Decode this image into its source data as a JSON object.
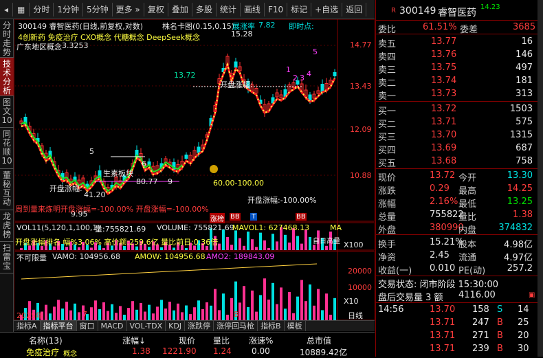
{
  "toolbar": {
    "items": [
      "分时",
      "1分钟",
      "5分钟",
      "更多",
      "复权",
      "叠加",
      "多股",
      "统计",
      "画线",
      "F10",
      "标记",
      "+自选",
      "返回"
    ]
  },
  "left_tabs": [
    "分时走势",
    "技术分析",
    "图文10",
    "同花顺10",
    "董秘互动",
    "龙虎榜",
    "扫雷宝"
  ],
  "chart": {
    "title": "300149 睿智医药(日线,前复权,对数)",
    "stock_window_label": "株名卡图(0.15,0.15)",
    "tab_zhang": "展涨率",
    "zhang_value": "7.82",
    "ji_shi": "即时点:",
    "concepts": "4创新药 免疫治疗 CXO概念 代糖概念 DeepSeek概念",
    "note_line": "广东地区概念",
    "dash_value": "3.3253",
    "price_labels": [
      "14.77",
      "13.43",
      "12.09",
      "10.88",
      "9.95"
    ],
    "price_axis_labels": [
      "14.77",
      "13.43",
      "12.09",
      "10.88"
    ],
    "high_label": "15.28",
    "low_label": "9.95",
    "level_label": "13.72",
    "open_zf_label": "开盘涨幅:",
    "open_zf_label2": "开盘涨幅:",
    "open_zf_label3": "开盘涨幅:-100.00%",
    "zhengti": "生素板块",
    "lbl_4120": "41.20",
    "lbl_8077": "80.77",
    "range_label": "60.00-100.00",
    "marks": [
      "5",
      "6",
      "9",
      "1",
      "2",
      "3",
      "4",
      "5"
    ],
    "bb_labels": [
      "BB",
      "T",
      "BB"
    ],
    "zhang_badge": "涨榜",
    "red_text": "周到量来炼明开盘涨幅=-100.00% 开盘涨幅=-100.00%",
    "xaxis": [
      "2025年",
      "7",
      "8"
    ],
    "day_label": "日线"
  },
  "vol_panel": {
    "title": "VOL11(5,120,1,100,1)",
    "vol": "量:755821.69",
    "volume": "VOLUME: 755821.69",
    "mavol": "MAVOL1: 627468.13",
    "ma_extra": "MA",
    "yellow_line": "开盘涨幅排名 幅%3.06% 高价额:259.6亿 量比前日:0.36倍",
    "scale": "X100",
    "right_label": "自日高量"
  },
  "amo_panel": {
    "title": "不可限量",
    "vamo": "VAMO: 104956.68",
    "amow": "AMOW: 104956.68",
    "amo2": "AMO2: 189843.09",
    "y_labels": [
      "20000",
      "10000"
    ],
    "scale": "X10"
  },
  "bottom_tabs": [
    "指标A",
    "指标平台",
    "窗口",
    "MACD",
    "VOL-TDX",
    "KDJ",
    "涨跌停",
    "涨停回马枪",
    "指标B",
    "模板"
  ],
  "table": {
    "headers": [
      "名称(13)",
      "涨幅↓",
      "现价",
      "量比",
      "涨速%",
      "总市值"
    ],
    "row": [
      "免疫治疗",
      "1.38",
      "1221.90",
      "1.24",
      "0.00",
      "10889.42亿"
    ],
    "row_tag": "概念"
  },
  "quote": {
    "code": "300149",
    "name": "睿智医药",
    "price": "14.23",
    "weibi_label": "委比",
    "weibi": "61.51%",
    "weicha_label": "委差",
    "weicha": "3685",
    "asks": [
      {
        "label": "卖五",
        "price": "13.77",
        "vol": "16"
      },
      {
        "label": "卖四",
        "price": "13.76",
        "vol": "146"
      },
      {
        "label": "卖三",
        "price": "13.75",
        "vol": "497"
      },
      {
        "label": "卖二",
        "price": "13.74",
        "vol": "181"
      },
      {
        "label": "卖一",
        "price": "13.73",
        "vol": "313"
      }
    ],
    "bids": [
      {
        "label": "买一",
        "price": "13.72",
        "vol": "1503"
      },
      {
        "label": "买二",
        "price": "13.71",
        "vol": "575"
      },
      {
        "label": "买三",
        "price": "13.70",
        "vol": "1315"
      },
      {
        "label": "买四",
        "price": "13.69",
        "vol": "687"
      },
      {
        "label": "买五",
        "price": "13.68",
        "vol": "758"
      }
    ],
    "stats": [
      {
        "l1": "现价",
        "v1": "13.72",
        "l2": "今开",
        "v2": "13.30"
      },
      {
        "l1": "涨跌",
        "v1": "0.29",
        "l2": "最高",
        "v2": "14.25"
      },
      {
        "l1": "涨幅",
        "v1": "2.16%",
        "l2": "最低",
        "v2": "13.25"
      },
      {
        "l1": "总量",
        "v1": "755822",
        "l2": "量比",
        "v2": "1.38"
      },
      {
        "l1": "外盘",
        "v1": "380990",
        "l2": "内盘",
        "v2": "374832"
      }
    ],
    "fund": [
      {
        "l1": "换手",
        "v1": "15.21%",
        "l2": "股本",
        "v2": "4.98亿"
      },
      {
        "l1": "净资",
        "v1": "2.45",
        "l2": "流通",
        "v2": "4.97亿"
      },
      {
        "l1": "收益(一)",
        "v1": "0.010",
        "l2": "PE(动)",
        "v2": "257.2"
      }
    ],
    "status": "交易状态: 闭市阶段 15:30:00",
    "after_label": "盘后交易量 3 额",
    "after_value": "4116.00",
    "ticks": [
      {
        "time": "14:56",
        "price": "13.70",
        "vol": "158",
        "flag": "S",
        "n": "14"
      },
      {
        "time": "",
        "price": "13.71",
        "vol": "247",
        "flag": "B",
        "n": "25"
      },
      {
        "time": "",
        "price": "13.71",
        "vol": "271",
        "flag": "B",
        "n": "20"
      },
      {
        "time": "",
        "price": "13.71",
        "vol": "239",
        "flag": "B",
        "n": "30"
      }
    ]
  }
}
